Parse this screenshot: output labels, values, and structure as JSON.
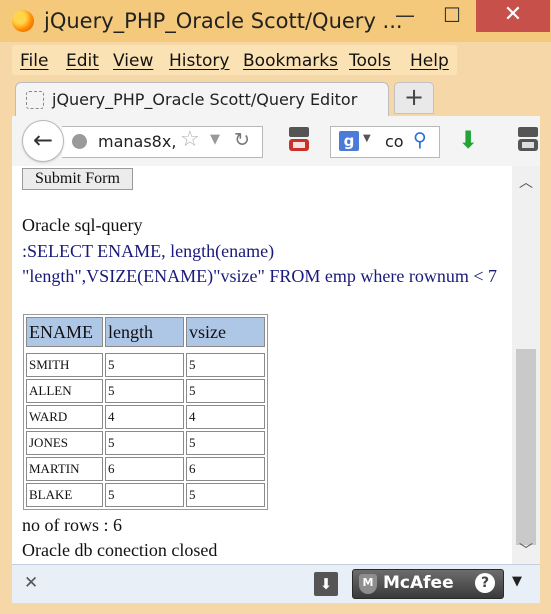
{
  "window": {
    "title": "jQuery_PHP_Oracle Scott/Query ...",
    "controls": {
      "minimize": "—",
      "maximize": "☐",
      "close": "✕"
    }
  },
  "menu": [
    "File",
    "Edit",
    "View",
    "History",
    "Bookmarks",
    "Tools",
    "Help"
  ],
  "tab": {
    "label": "jQuery_PHP_Oracle Scott/Query Editor",
    "new_tab": "+"
  },
  "nav": {
    "back": "←",
    "url": "manas8x,",
    "search_engine": "g",
    "search_text": "co",
    "icons": [
      "globe-icon",
      "star-icon",
      "reload-icon",
      "youtube-icon",
      "google-icon",
      "search-icon",
      "download-icon"
    ]
  },
  "page": {
    "submit_label": "Submit Form",
    "section_label": "Oracle sql-query",
    "query_text": ":SELECT ENAME, length(ename) \"length\",VSIZE(ENAME)\"vsize\" FROM emp where rownum < 7",
    "table": {
      "headers": [
        "ENAME",
        "length",
        "vsize"
      ],
      "rows": [
        [
          "SMITH",
          "5",
          "5"
        ],
        [
          "ALLEN",
          "5",
          "5"
        ],
        [
          "WARD",
          "4",
          "4"
        ],
        [
          "JONES",
          "5",
          "5"
        ],
        [
          "MARTIN",
          "6",
          "6"
        ],
        [
          "BLAKE",
          "5",
          "5"
        ]
      ]
    },
    "row_count": "no of rows : 6",
    "status": "Oracle db conection closed"
  },
  "addon_bar": {
    "close": "✕",
    "mcafee_label": "McAfee",
    "help": "?",
    "menu": "▼"
  },
  "colors": {
    "header_bg": "#afc7e6",
    "query_text": "#1a1a7a",
    "titlebar": "#f5c97b"
  }
}
